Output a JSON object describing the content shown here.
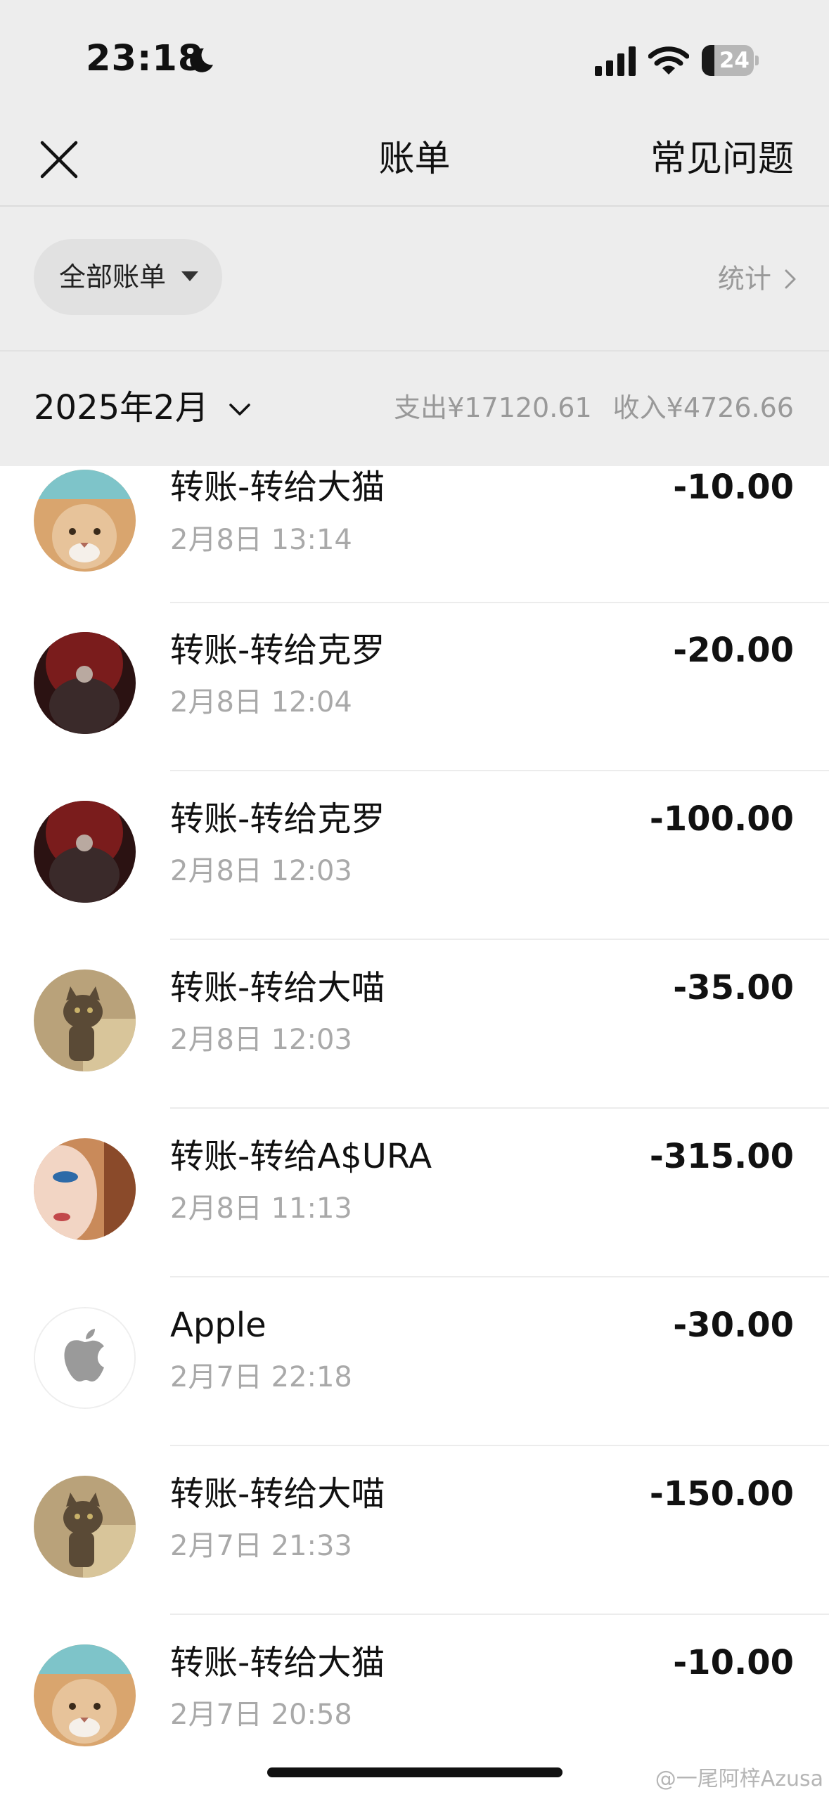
{
  "status_bar": {
    "time": "23:18",
    "battery": "24",
    "battery_level": 0.24
  },
  "nav": {
    "title": "账单",
    "faq": "常见问题"
  },
  "filter": {
    "label": "全部账单",
    "stats": "统计"
  },
  "month_bar": {
    "month": "2025年2月",
    "expense": "支出¥17120.61",
    "income": "收入¥4726.66"
  },
  "transactions": [
    {
      "title": "转账-转给大猫",
      "time": "2月8日 13:14",
      "amount": "-10.00",
      "avatar": "cat-hat"
    },
    {
      "title": "转账-转给克罗",
      "time": "2月8日 12:04",
      "amount": "-20.00",
      "avatar": "dark-red"
    },
    {
      "title": "转账-转给克罗",
      "time": "2月8日 12:03",
      "amount": "-100.00",
      "avatar": "dark-red"
    },
    {
      "title": "转账-转给大喵",
      "time": "2月8日 12:03",
      "amount": "-35.00",
      "avatar": "tabby-cat"
    },
    {
      "title": "转账-转给A$URA",
      "time": "2月8日 11:13",
      "amount": "-315.00",
      "avatar": "face"
    },
    {
      "title": "Apple",
      "time": "2月7日 22:18",
      "amount": "-30.00",
      "avatar": "apple-logo"
    },
    {
      "title": "转账-转给大喵",
      "time": "2月7日 21:33",
      "amount": "-150.00",
      "avatar": "tabby-cat"
    },
    {
      "title": "转账-转给大猫",
      "time": "2月7日 20:58",
      "amount": "-10.00",
      "avatar": "cat-hat"
    }
  ],
  "watermark": "@一尾阿梓Azusa"
}
